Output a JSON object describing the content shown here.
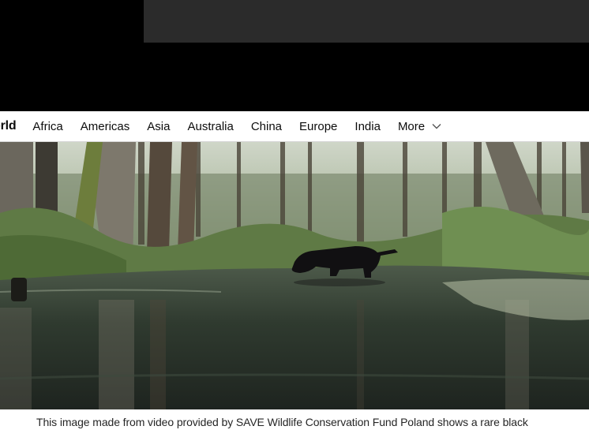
{
  "nav": {
    "section_title": "orld",
    "items": [
      {
        "label": "Africa"
      },
      {
        "label": "Americas"
      },
      {
        "label": "Asia"
      },
      {
        "label": "Australia"
      },
      {
        "label": "China"
      },
      {
        "label": "Europe"
      },
      {
        "label": "India"
      }
    ],
    "more_label": "More",
    "more_icon": "chevron-down-icon"
  },
  "photo": {
    "subject": "black-animal-wading-in-forest-stream"
  },
  "caption": {
    "text": "This image made from video provided by SAVE Wildlife Conservation Fund Poland shows a rare black"
  },
  "colors": {
    "nav_background": "#ffffff",
    "page_background": "#000000",
    "text": "#0c0c0c",
    "ad_slot": "#2b2b2b"
  }
}
